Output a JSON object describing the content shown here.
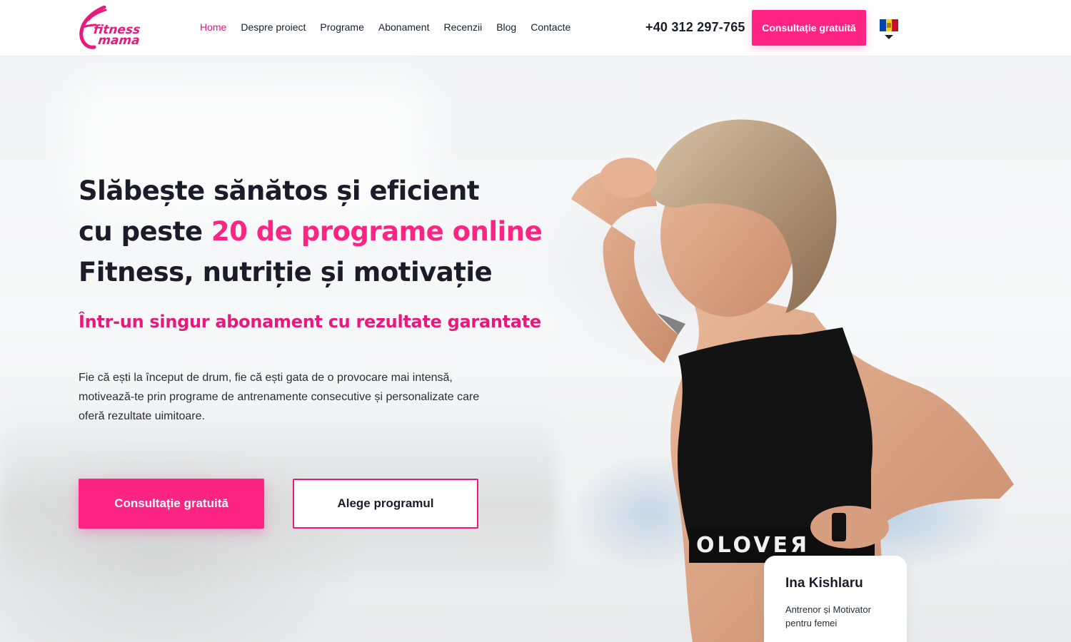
{
  "header": {
    "logo": {
      "line1": "fitness",
      "line2": "mama"
    },
    "nav": [
      {
        "label": "Home",
        "active": true
      },
      {
        "label": "Despre proiect",
        "active": false
      },
      {
        "label": "Programe",
        "active": false
      },
      {
        "label": "Abonament",
        "active": false
      },
      {
        "label": "Recenzii",
        "active": false
      },
      {
        "label": "Blog",
        "active": false
      },
      {
        "label": "Contacte",
        "active": false
      }
    ],
    "phone": "+40 312 297-765",
    "cta_label": "Consultație gratuită",
    "language_flag": "moldova-flag-icon"
  },
  "hero": {
    "headline_line1": "Slăbește sănătos și eficient",
    "headline_line2_prefix": "cu peste ",
    "headline_line2_highlight": "20 de programe online",
    "headline_line3": "Fitness, nutriție și motivație",
    "subline": "Într-un singur abonament cu rezultate garantate",
    "description": "Fie că ești la început de drum, fie că ești gata de o provocare mai intensă, motivează-te prin programe de antrenamente consecutive și personalizate care oferă rezultate uimitoare.",
    "primary_button": "Consultație gratuită",
    "secondary_button": "Alege programul"
  },
  "trainer": {
    "name": "Ina Kishlaru",
    "role": "Antrenor și Motivator pentru femei"
  },
  "colors": {
    "accent": "#fe2484",
    "accent_text": "#e8197d",
    "text": "#1a1d29"
  }
}
